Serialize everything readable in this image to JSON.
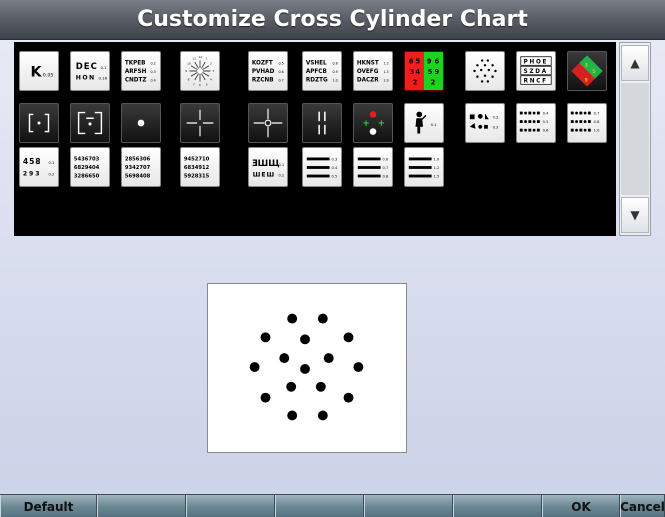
{
  "window": {
    "title": "Customize Cross Cylinder Chart"
  },
  "tiles": {
    "k": "K",
    "k_sub": "0.05",
    "dec_row1": "DEC",
    "dec_row1_sub": "0.1",
    "dec_row2": "HON",
    "dec_row2_sub": "0.16",
    "tkp_row1": "TKPEB",
    "tkp_row1_sub": "0.2",
    "tkp_row2": "ARFSH",
    "tkp_row2_sub": "0.3",
    "tkp_row3": "CNDTZ",
    "tkp_row3_sub": "0.4",
    "koz_row1": "KOZFT",
    "koz_row1_sub": "0.5",
    "koz_row2": "PVHAD",
    "koz_row2_sub": "0.6",
    "koz_row3": "RZCNB",
    "koz_row3_sub": "0.7",
    "vsh_row1": "VSHEL",
    "vsh_row1_sub": "0.8",
    "vsh_row2": "APFCB",
    "vsh_row2_sub": "0.9",
    "vsh_row3": "RDZTG",
    "vsh_row3_sub": "1.0",
    "hkn_row1": "HKNST",
    "hkn_row1_sub": "1.2",
    "hkn_row2": "OVEFG",
    "hkn_row2_sub": "1.5",
    "hkn_row3": "DACZR",
    "hkn_row3_sub": "2.0",
    "rg_r1": "6",
    "rg_r2": "5",
    "rg_r3": "3",
    "rg_r4": "4",
    "rg_r5": "2",
    "rg_g1": "9",
    "rg_g2": "6",
    "rg_g3": "5",
    "rg_g4": "9",
    "rg_g5": "2",
    "phoe_row1": "PHOE",
    "phoe_row2": "SZDA",
    "phoe_row3": "RNCF",
    "fig_sub": "0.1",
    "pic1_sub1": "0.2",
    "pic1_sub2": "0.3",
    "pic2_sub1": "0.4",
    "pic2_sub2": "0.5",
    "pic2_sub3": "0.6",
    "pic3_sub1": "0.7",
    "pic3_sub2": "0.8",
    "pic3_sub3": "1.0",
    "n1_row1": "458",
    "n1_row1_sub": "0.1",
    "n1_row2": "293",
    "n1_row2_sub": "0.2",
    "n2_row1": "5436703",
    "n2_row2": "6829404",
    "n2_row3": "3286650",
    "n3_row1": "2856306",
    "n3_row2": "9342707",
    "n3_row3": "5698408",
    "n4_row1": "9452710",
    "n4_row2": "6834912",
    "n4_row3": "5928315",
    "e1_row1": "ƎШЩ",
    "e1_row1_sub": "0.1",
    "e1_row2": "ШEШ",
    "e1_row2_sub": "0.2",
    "e2_sub1": "0.3",
    "e2_sub2": "0.4",
    "e2_sub3": "0.5",
    "e3_sub1": "0.6",
    "e3_sub2": "0.7",
    "e3_sub3": "0.8",
    "e4_sub1": "1.0",
    "e4_sub2": "1.2",
    "e4_sub3": "1.5"
  },
  "bottom": {
    "default_label": "Default",
    "ok_label": "OK",
    "cancel_label": "Cancel"
  }
}
